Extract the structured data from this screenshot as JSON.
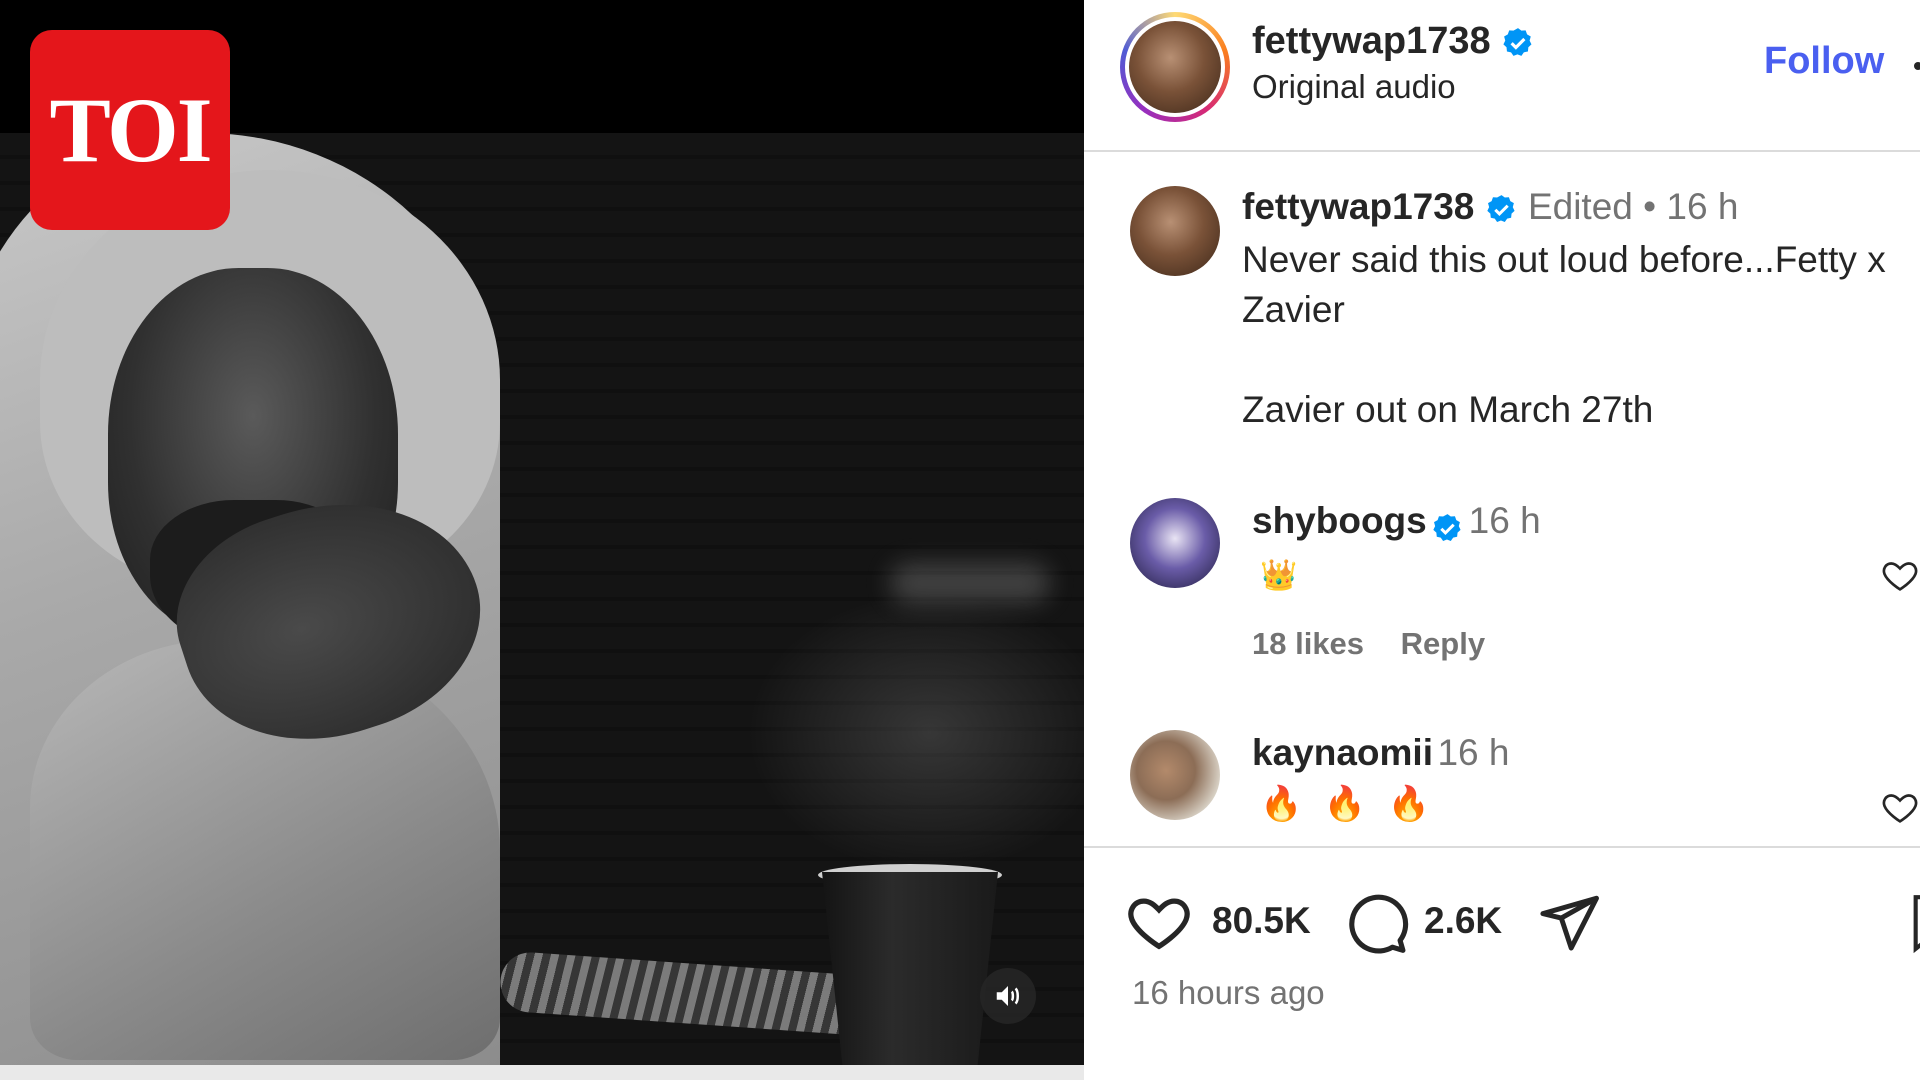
{
  "logo": {
    "text": "TOI",
    "color": "#e4161b"
  },
  "post": {
    "username": "fettywap1738",
    "audio": "Original audio",
    "follow_label": "Follow",
    "accent_color": "#4a5ff0"
  },
  "caption": {
    "username": "fettywap1738",
    "edited_label": "Edited",
    "separator": "•",
    "time": "16 h",
    "line1": "Never said this out loud before...Fetty x",
    "line2": "Zavier",
    "line3": "Zavier out on March 27th"
  },
  "comments": [
    {
      "username": "shyboogs",
      "verified": true,
      "time": "16 h",
      "text": "👑",
      "likes": "18 likes",
      "reply": "Reply",
      "avatar_icon": "wizard-avatar"
    },
    {
      "username": "kaynaomii",
      "verified": false,
      "time": "16 h",
      "text": "🔥 🔥 🔥",
      "avatar_icon": "photo-avatar"
    }
  ],
  "actions": {
    "likes": "80.5K",
    "comments": "2.6K",
    "posted": "16 hours ago"
  },
  "icons": [
    "speaker-icon",
    "verified-badge-icon",
    "heart-icon",
    "comment-icon",
    "share-icon",
    "bookmark-icon",
    "more-icon"
  ]
}
